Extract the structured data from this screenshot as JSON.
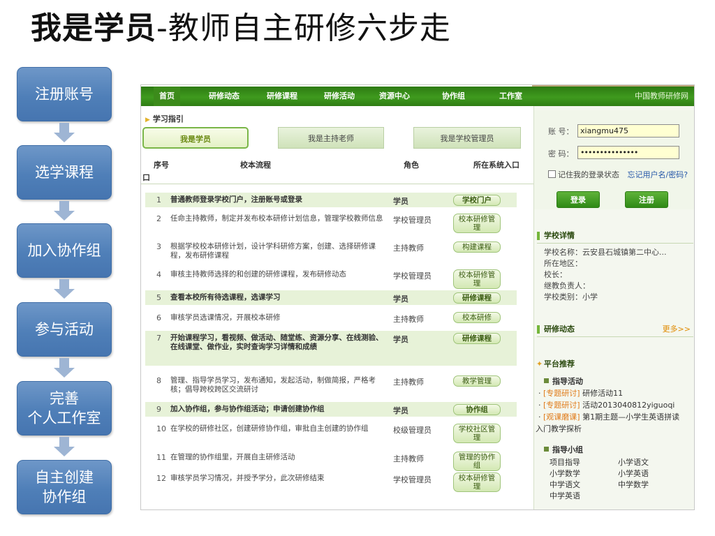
{
  "title": {
    "bold": "我是学员",
    "rest": "-教师自主研修六步走"
  },
  "steps": [
    "注册账号",
    "选学课程",
    "加入协作组",
    "参与活动",
    "完善\n个人工作室",
    "自主创建\n协作组"
  ],
  "nav": {
    "items": [
      "首页",
      "研修动态",
      "研修课程",
      "研修活动",
      "资源中心",
      "协作组",
      "工作室"
    ],
    "site_name": "中国教师研修网"
  },
  "guide": {
    "title": "学习指引",
    "tabs": [
      "我是学员",
      "我是主持老师",
      "我是学校管理员"
    ],
    "columns": {
      "num": "序号",
      "process": "校本流程",
      "role": "角色",
      "entry": "所在系统入口",
      "entry_wrap": "口"
    },
    "rows": [
      {
        "num": "1",
        "desc": "普通教师登录学校门户，注册账号或登录",
        "role": "学员",
        "sys": "学校门户",
        "highlight": true
      },
      {
        "num": "2",
        "desc": "任命主持教师，制定并发布校本研修计划信息，管理学校教师信息",
        "role": "学校管理员",
        "sys": "校本研修管理",
        "highlight": false
      },
      {
        "num": "3",
        "desc": "根据学校校本研修计划，设计学科研修方案，创建、选择研修课程，发布研修课程",
        "role": "主持教师",
        "sys": "构建课程",
        "highlight": false
      },
      {
        "num": "4",
        "desc": "审核主持教师选择的和创建的研修课程，发布研修动态",
        "role": "学校管理员",
        "sys": "校本研修管理",
        "highlight": false
      },
      {
        "num": "5",
        "desc": "查看本校所有待选课程，选课学习",
        "role": "学员",
        "sys": "研修课程",
        "highlight": true
      },
      {
        "num": "6",
        "desc": "审核学员选课情况，开展校本研修",
        "role": "主持教师",
        "sys": "校本研修",
        "highlight": false
      },
      {
        "num": "7",
        "desc": "开始课程学习，看视频、做活动、随堂练、资源分享、在线测验、在线课堂、做作业，实时查询学习详情和成绩",
        "role": "学员",
        "sys": "研修课程",
        "highlight": true
      },
      {
        "num": "8",
        "desc": "管理、指导学员学习，发布通知，发起活动，制做简报，严格考核；倡导跨校跨区交流研讨",
        "role": "主持教师",
        "sys": "教学管理",
        "highlight": false
      },
      {
        "num": "9",
        "desc": "加入协作组，参与协作组活动；申请创建协作组",
        "role": "学员",
        "sys": "协作组",
        "highlight": true
      },
      {
        "num": "10",
        "desc": "在学校的研修社区，创建研修协作组，审批自主创建的协作组",
        "role": "校级管理员",
        "sys": "学校社区管理",
        "highlight": false
      },
      {
        "num": "11",
        "desc": "在管理的协作组里，开展自主研修活动",
        "role": "主持教师",
        "sys": "管理的协作组",
        "highlight": false
      },
      {
        "num": "12",
        "desc": "审核学员学习情况，并授予学分，此次研修结束",
        "role": "学校管理员",
        "sys": "校本研修管理",
        "highlight": false
      }
    ]
  },
  "login": {
    "account_label": "账 号：",
    "account_value": "xiangmu475",
    "password_label": "密 码：",
    "password_value": "•••••••••••••••",
    "remember": "记住我的登录状态",
    "forgot": "忘记用户名/密码?",
    "login_button": "登录",
    "register_button": "注册"
  },
  "school": {
    "title": "学校详情",
    "lines": [
      "学校名称：云安县石城镇第二中心...",
      "所在地区：",
      "校长：",
      "继教负责人：",
      "学校类别：小学"
    ]
  },
  "news": {
    "title": "研修动态",
    "more": "更多>>"
  },
  "recommend": {
    "title": "平台推荐",
    "activity_title": "指导活动",
    "activities": [
      {
        "tag": "[专题研讨]",
        "text": "研修活动11"
      },
      {
        "tag": "[专题研讨]",
        "text": "活动2013040812yiguoqi"
      },
      {
        "tag": "[观课磨课]",
        "text": "第1期主题—小学生英语拼读"
      }
    ],
    "activity_wrap": "入门教学探析",
    "group_title": "指导小组",
    "groups": [
      "项目指导",
      "小学语文",
      "小学数学",
      "小学英语",
      "中学语文",
      "中学数学",
      "中学英语"
    ]
  }
}
